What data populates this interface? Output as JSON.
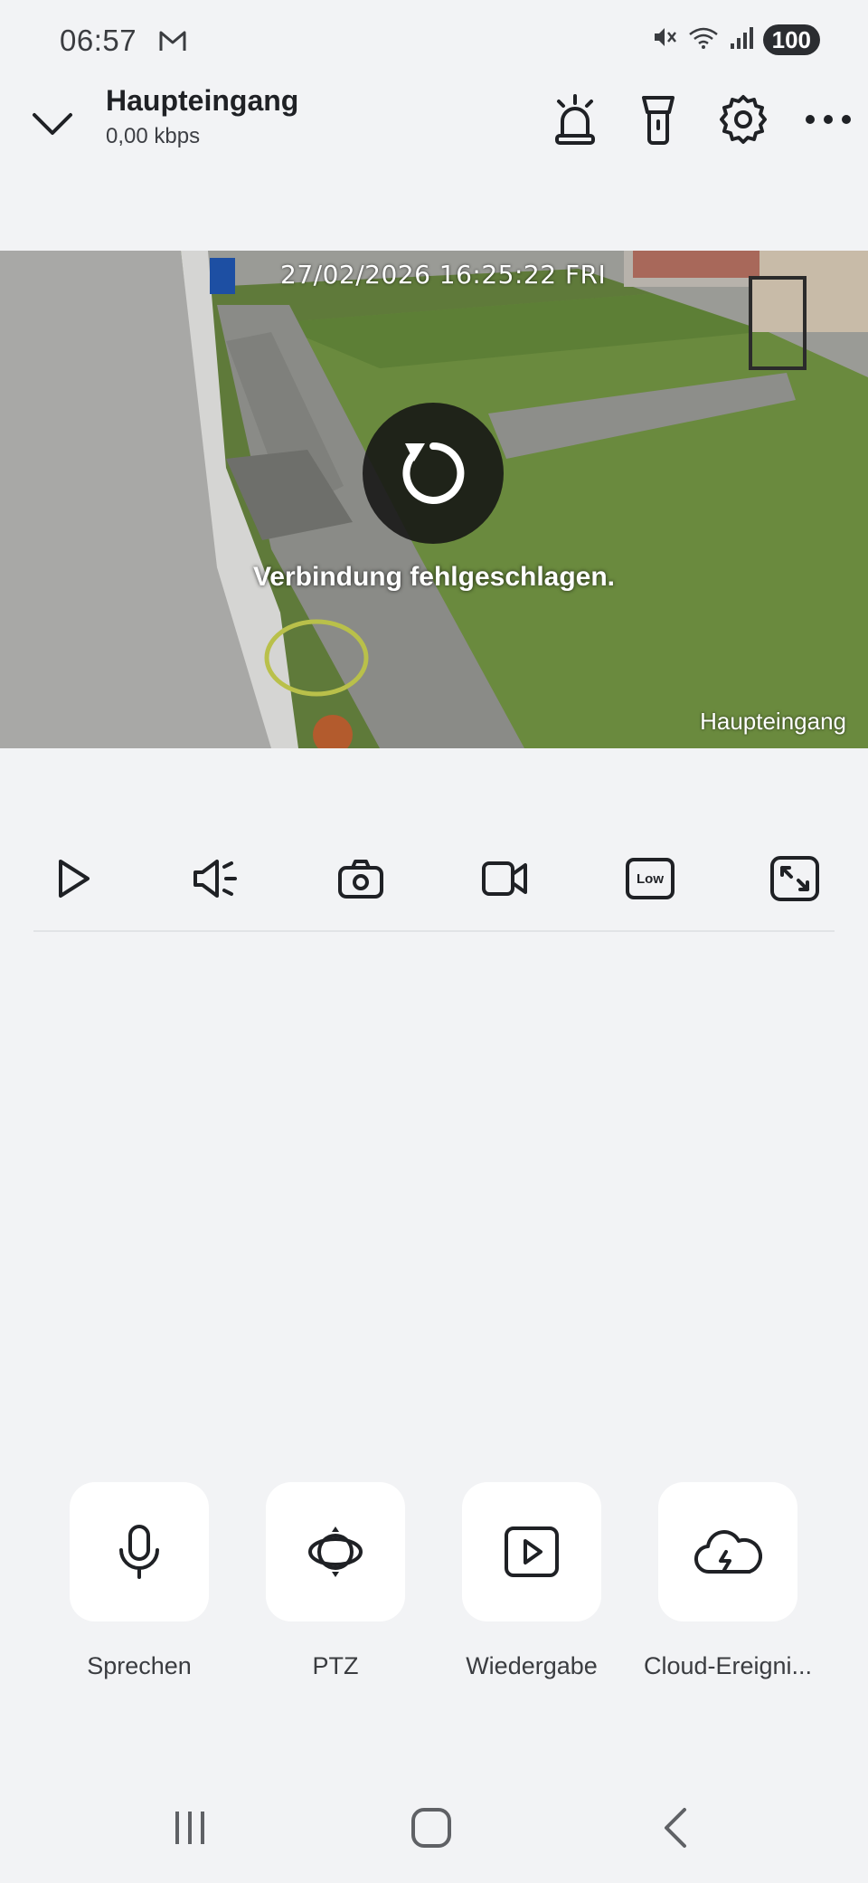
{
  "status_bar": {
    "time": "06:57",
    "battery": "100",
    "icons": [
      "gmail-icon",
      "mute-icon",
      "wifi-icon",
      "signal-icon"
    ]
  },
  "header": {
    "title": "Haupteingang",
    "bitrate": "0,00 kbps",
    "icons": [
      "chevron-down-icon",
      "siren-icon",
      "flashlight-icon",
      "gear-icon",
      "more-icon"
    ]
  },
  "video": {
    "timestamp": "27/02/2026 16:25:22 FRI",
    "camera_label": "Haupteingang",
    "error_message": "Verbindung fehlgeschlagen."
  },
  "controls": {
    "items": [
      "play-icon",
      "speaker-icon",
      "snapshot-icon",
      "record-icon",
      "quality-icon",
      "fullscreen-icon"
    ],
    "quality_label": "Low"
  },
  "actions": [
    {
      "label": "Sprechen",
      "icon": "microphone-icon"
    },
    {
      "label": "PTZ",
      "icon": "ptz-icon"
    },
    {
      "label": "Wiedergabe",
      "icon": "playback-icon"
    },
    {
      "label": "Cloud-Ereigni...",
      "icon": "cloud-icon"
    }
  ],
  "navbar": {
    "icons": [
      "recent-apps-icon",
      "home-icon",
      "back-icon"
    ]
  }
}
